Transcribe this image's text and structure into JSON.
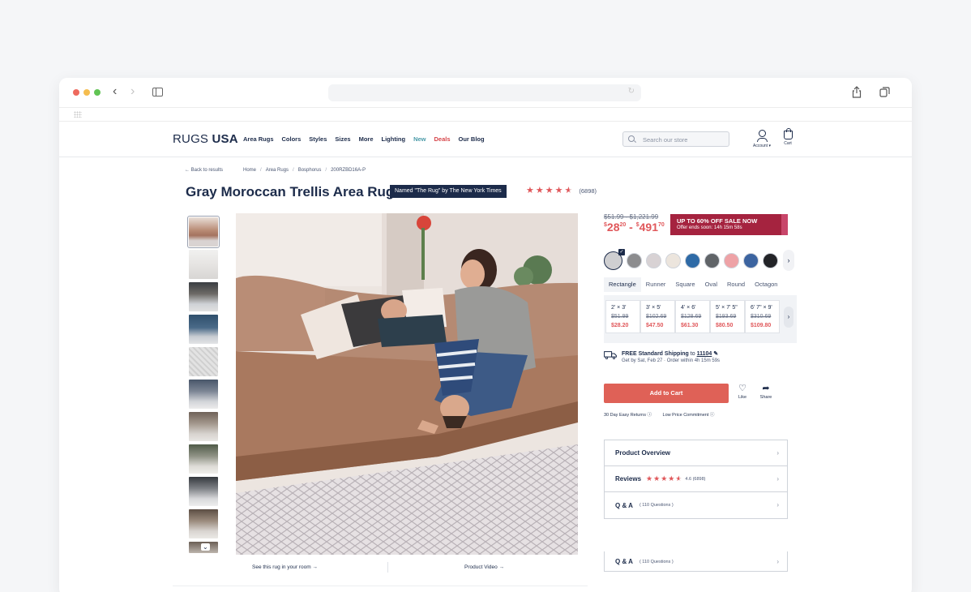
{
  "browser": {
    "address": ""
  },
  "header": {
    "logo_light": "RUGS",
    "logo_bold": "USA",
    "nav": [
      "Area Rugs",
      "Colors",
      "Styles",
      "Sizes",
      "More",
      "Lighting",
      "New",
      "Deals",
      "Our Blog"
    ],
    "search_placeholder": "Search our store",
    "account_label": "Account",
    "cart_label": "Cart"
  },
  "breadcrumb": {
    "back": "← Back to results",
    "items": [
      "Home",
      "Area Rugs",
      "Bosphorus",
      "200RZBD16A-P"
    ]
  },
  "product": {
    "title": "Gray Moroccan Trellis Area Rug",
    "badge": "Named \"The Rug\" by The New York Times",
    "rating": 4.6,
    "review_count": "(6898)"
  },
  "media": {
    "room_link": "See this rug in your room →",
    "video_link": "Product Video →"
  },
  "pricing": {
    "old_range": "$51.99 - $1,221.99",
    "new_from_dollars": "28",
    "new_from_cents": "20",
    "new_to_dollars": "491",
    "new_to_cents": "70",
    "sale_title": "UP TO 60% OFF SALE NOW",
    "sale_sub": "Offer ends soon: 14h 15m 58s"
  },
  "colors": {
    "swatches": [
      "#cfcfd1",
      "#8c8c8e",
      "#d8d2d4",
      "#ece5dd",
      "#2e6aa6",
      "#606468",
      "#eea2a6",
      "#3c64a0",
      "#232428"
    ]
  },
  "shapes": [
    "Rectangle",
    "Runner",
    "Square",
    "Oval",
    "Round",
    "Octagon"
  ],
  "sizes": [
    {
      "label": "2' × 3'",
      "old": "$51.99",
      "new": "$28.20"
    },
    {
      "label": "3' × 5'",
      "old": "$102.69",
      "new": "$47.50"
    },
    {
      "label": "4' × 6'",
      "old": "$128.69",
      "new": "$61.30"
    },
    {
      "label": "5' × 7' 5\"",
      "old": "$193.69",
      "new": "$80.50"
    },
    {
      "label": "6' 7\" × 9'",
      "old": "$310.69",
      "new": "$109.80"
    }
  ],
  "shipping": {
    "title": "FREE Standard Shipping",
    "to": "to",
    "zip": "11104",
    "eta": "Get by Sat, Feb 27 · Order within 4h 15m 59s"
  },
  "actions": {
    "add_to_cart": "Add to Cart",
    "like": "Like",
    "share": "Share",
    "returns": "30 Day Easy Returns ⓘ",
    "price_commitment": "Low Price Commitment ⓘ"
  },
  "accordion": {
    "overview": "Product Overview",
    "reviews": "Reviews",
    "reviews_meta": "4.6 (6898)",
    "qa": "Q & A",
    "qa_meta": "( 110 Questions )"
  }
}
